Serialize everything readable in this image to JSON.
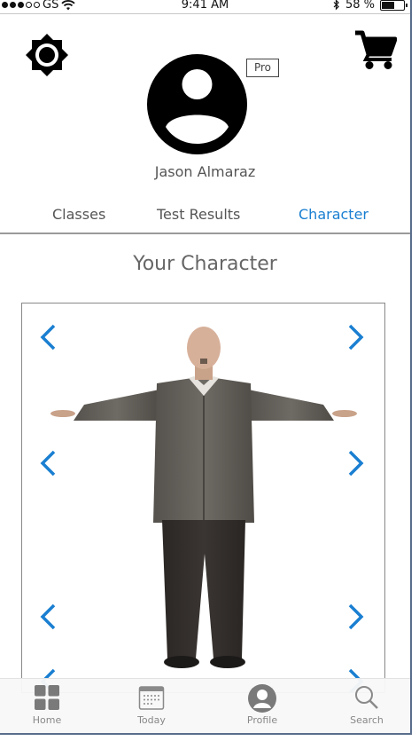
{
  "status_bar": {
    "carrier": "GS",
    "time": "9:41 AM",
    "battery": "58 %",
    "battery_level": 0.58
  },
  "header": {
    "settings_icon": "brightness-gear-icon",
    "cart_icon": "shopping-cart-icon",
    "avatar_icon": "account-circle-icon",
    "badge": "Pro",
    "user_name": "Jason Almaraz"
  },
  "tabs": [
    {
      "label": "Classes",
      "active": false
    },
    {
      "label": "Test Results",
      "active": false
    },
    {
      "label": "Character",
      "active": true
    }
  ],
  "main": {
    "title": "Your Character"
  },
  "viewer": {
    "arrows_left": [
      "chevron-left-icon",
      "chevron-left-icon",
      "chevron-left-icon",
      "chevron-left-icon"
    ],
    "arrows_right": [
      "chevron-right-icon",
      "chevron-right-icon",
      "chevron-right-icon",
      "chevron-right-icon"
    ]
  },
  "bottom_nav": [
    {
      "label": "Home",
      "icon": "grid-icon"
    },
    {
      "label": "Today",
      "icon": "calendar-icon"
    },
    {
      "label": "Profile",
      "icon": "person-icon"
    },
    {
      "label": "Search",
      "icon": "search-icon"
    }
  ],
  "colors": {
    "accent": "#1a7fd1",
    "text": "#555555",
    "frame": "#5a6e8c"
  }
}
